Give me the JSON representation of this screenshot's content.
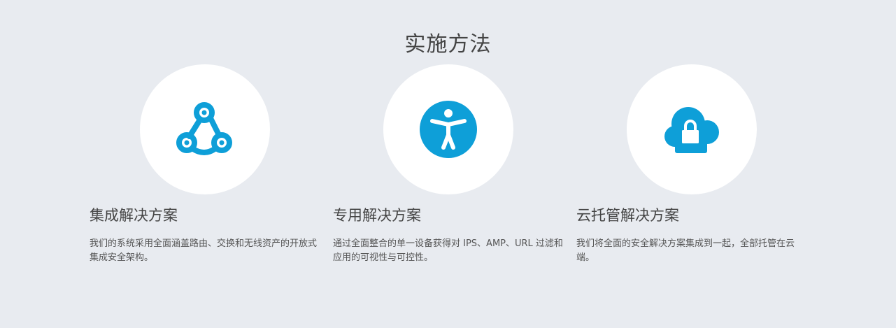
{
  "page": {
    "title": "实施方法"
  },
  "solutions": [
    {
      "icon": "webhook-icon",
      "title": "集成解决方案",
      "description": "我们的系统采用全面涵盖路由、交换和无线资产的开放式集成安全架构。"
    },
    {
      "icon": "accessibility-icon",
      "title": "专用解决方案",
      "description": "通过全面整合的单一设备获得对 IPS、AMP、URL 过滤和应用的可视性与可控性。"
    },
    {
      "icon": "cloud-lock-icon",
      "title": "云托管解决方案",
      "description": "我们将全面的安全解决方案集成到一起，全部托管在云端。"
    }
  ],
  "colors": {
    "background": "#e8ebf0",
    "accent": "#0e9fd8",
    "circle": "#ffffff"
  }
}
